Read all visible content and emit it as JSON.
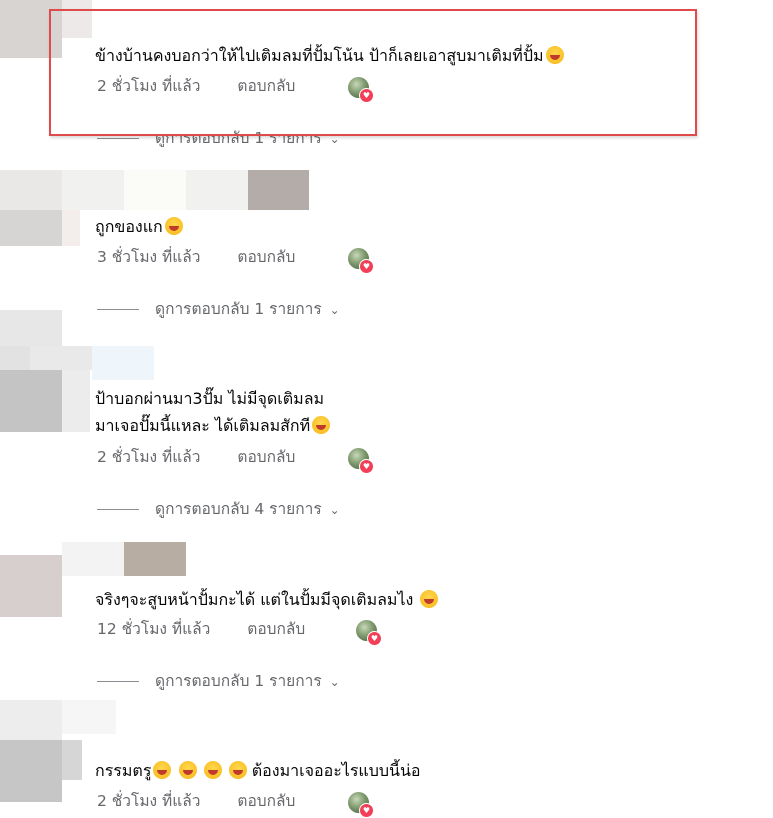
{
  "comments": [
    {
      "lines": [
        "ข้างบ้านคงบอกว่าให้ไปเติมลมที่ปั้มโน้น ป้าก็เลยเอาสูบมาเติมที่ปั้ม"
      ],
      "time": "2 ชั่วโมง ที่แล้ว",
      "reply": "ตอบกลับ",
      "view_replies": "ดูการตอบกลับ 1 รายการ"
    },
    {
      "lines": [
        "ถูกของแก"
      ],
      "time": "3 ชั่วโมง ที่แล้ว",
      "reply": "ตอบกลับ",
      "view_replies": "ดูการตอบกลับ 1 รายการ"
    },
    {
      "lines": [
        "ป้าบอกผ่านมา3ปั๊ม ไม่มีจุดเติมลม",
        "มาเจอปั๊มนี้แหละ ได้เติมลมสักที"
      ],
      "time": "2 ชั่วโมง ที่แล้ว",
      "reply": "ตอบกลับ",
      "view_replies": "ดูการตอบกลับ 4 รายการ"
    },
    {
      "lines": [
        "จริงๆจะสูบหน้าปั้มกะได้ แต่ในปั้มมีจุดเติมลมไง"
      ],
      "time": "12 ชั่วโมง ที่แล้ว",
      "reply": "ตอบกลับ",
      "view_replies": "ดูการตอบกลับ 1 รายการ"
    },
    {
      "lines": [
        "กรรมตรู",
        "ต้องมาเจออะไรแบบนี้น่อ"
      ],
      "time": "2 ชั่วโมง ที่แล้ว",
      "reply": "ตอบกลับ"
    }
  ],
  "colors": {
    "highlight_border": "#e04a4a",
    "meta_text": "#65676b",
    "reaction_heart": "#f33e58"
  },
  "icons": {
    "reaction": "heart-reaction-icon",
    "emoji_laugh": "laughing-emoji-icon",
    "emoji_grin": "grinning-emoji-icon",
    "emoji_sweat": "sweat-smile-emoji-icon",
    "chevron": "chevron-down-icon"
  }
}
